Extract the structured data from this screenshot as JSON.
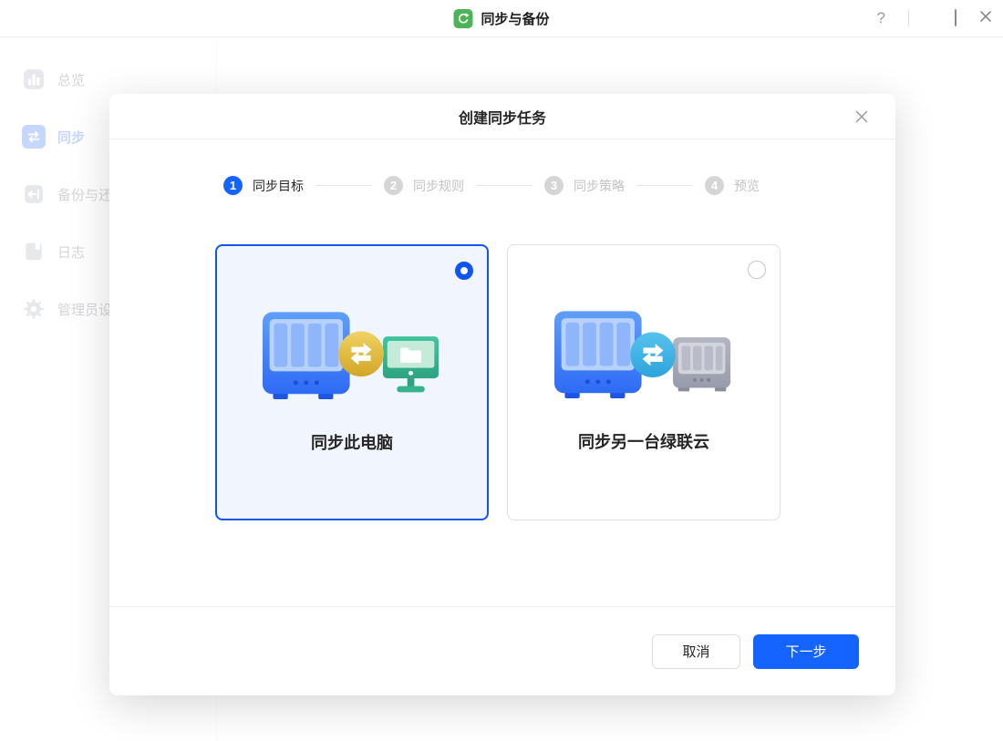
{
  "window": {
    "title": "同步与备份",
    "help_label": "?"
  },
  "sidebar": {
    "items": [
      {
        "label": "总览",
        "icon": "overview-icon",
        "active": false
      },
      {
        "label": "同步",
        "icon": "sync-icon",
        "active": true
      },
      {
        "label": "备份与还原",
        "icon": "backup-restore-icon",
        "active": false
      },
      {
        "label": "日志",
        "icon": "log-icon",
        "active": false
      },
      {
        "label": "管理员设置",
        "icon": "admin-settings-icon",
        "active": false
      }
    ]
  },
  "modal": {
    "title": "创建同步任务",
    "steps": [
      {
        "num": "1",
        "label": "同步目标",
        "active": true
      },
      {
        "num": "2",
        "label": "同步规则",
        "active": false
      },
      {
        "num": "3",
        "label": "同步策略",
        "active": false
      },
      {
        "num": "4",
        "label": "预览",
        "active": false
      }
    ],
    "options": [
      {
        "label": "同步此电脑",
        "selected": true,
        "illustration": "nas-sync-pc"
      },
      {
        "label": "同步另一台绿联云",
        "selected": false,
        "illustration": "nas-sync-nas"
      }
    ],
    "buttons": {
      "cancel": "取消",
      "next": "下一步"
    }
  },
  "colors": {
    "primary_blue": "#1664ff",
    "app_icon_green": "#4cb456",
    "selected_card_bg": "#f0f5fe",
    "selected_card_border": "#1057f0",
    "gold_badge": "#ddb132",
    "cyan_badge": "#41b2e3",
    "inactive_step": "#d5d5d5",
    "dim_overlay": "rgba(255,255,255,0.72)"
  }
}
